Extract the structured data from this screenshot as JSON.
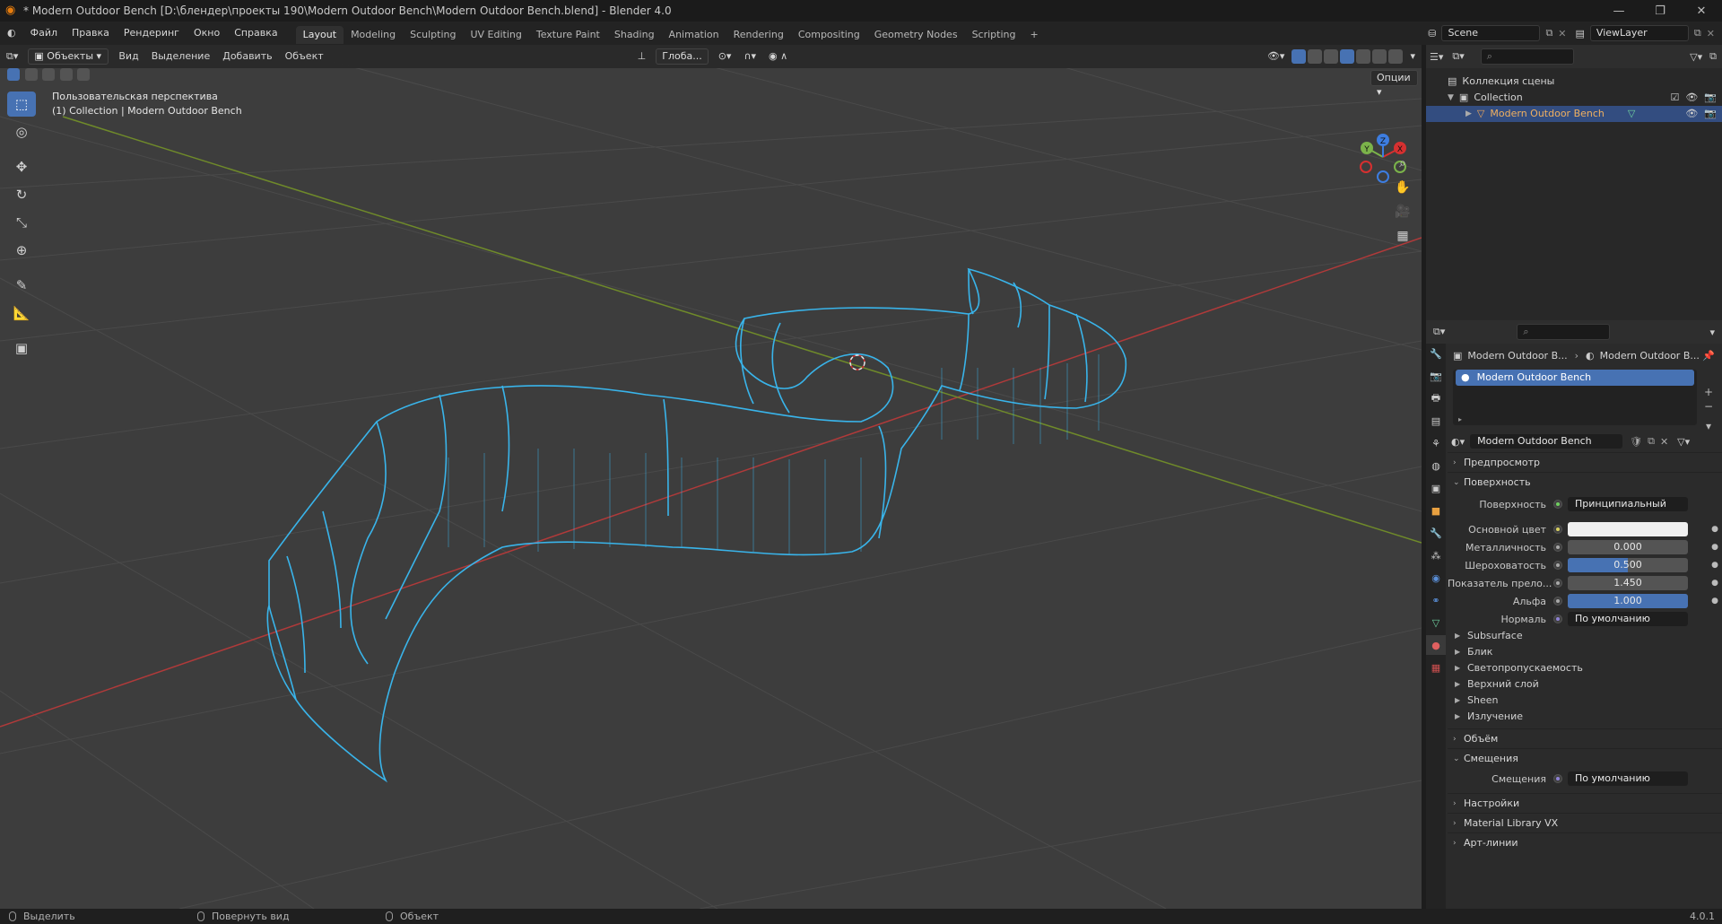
{
  "window": {
    "title": "* Modern Outdoor Bench [D:\\блендер\\проекты 190\\Modern Outdoor Bench\\Modern Outdoor Bench.blend] - Blender 4.0",
    "minimize": "—",
    "maximize": "❐",
    "close": "✕"
  },
  "menu": {
    "items": [
      "Файл",
      "Правка",
      "Рендеринг",
      "Окно",
      "Справка"
    ],
    "workspaces": [
      "Layout",
      "Modeling",
      "Sculpting",
      "UV Editing",
      "Texture Paint",
      "Shading",
      "Animation",
      "Rendering",
      "Compositing",
      "Geometry Nodes",
      "Scripting"
    ],
    "add_tab": "+",
    "scene": "Scene",
    "view_layer": "ViewLayer"
  },
  "viewport": {
    "mode": "Объекты",
    "menus": [
      "Вид",
      "Выделение",
      "Добавить",
      "Объект"
    ],
    "transform_orientation": "Глоба...",
    "options": "Опции",
    "info_line1": "Пользовательская перспектива",
    "info_line2": "(1) Collection | Modern Outdoor Bench",
    "gizmo": {
      "x": "X",
      "y": "Y",
      "z": "Z"
    }
  },
  "outliner": {
    "scene_collection": "Коллекция сцены",
    "collection": "Collection",
    "object": "Modern Outdoor Bench",
    "search_placeholder": ""
  },
  "properties": {
    "breadcrumb_object": "Modern Outdoor B...",
    "breadcrumb_material": "Modern Outdoor B...",
    "material_slot": "Modern Outdoor Bench",
    "material_name": "Modern Outdoor Bench",
    "sections": {
      "preview": "Предпросмотр",
      "surface": "Поверхность",
      "volume": "Объём",
      "displacement": "Смещения",
      "settings": "Настройки",
      "material_library": "Material Library VX",
      "line_art": "Арт-линии"
    },
    "surface_label": "Поверхность",
    "surface_value": "Принципиальный BSDF",
    "base_color_label": "Основной цвет",
    "base_color": "#f0f0f0",
    "metallic_label": "Металличность",
    "metallic": "0.000",
    "roughness_label": "Шероховатость",
    "roughness": "0.500",
    "roughness_fill": 0.5,
    "ior_label": "Показатель прело...",
    "ior": "1.450",
    "alpha_label": "Альфа",
    "alpha": "1.000",
    "alpha_fill": 1.0,
    "normal_label": "Нормаль",
    "normal_value": "По умолчанию",
    "subpanels": [
      "Subsurface",
      "Блик",
      "Светопропускаемость",
      "Верхний слой",
      "Sheen",
      "Излучение"
    ],
    "displacement_label": "Смещения",
    "displacement_value": "По умолчанию"
  },
  "status": {
    "select": "Выделить",
    "rotate": "Повернуть вид",
    "object": "Объект",
    "version": "4.0.1"
  },
  "colors": {
    "accent": "#4772b3",
    "wireframe": "#39b4ea",
    "viewport_bg": "#3d3d3d",
    "axis_x": "#c83c3c",
    "axis_y": "#7a9a2a"
  }
}
